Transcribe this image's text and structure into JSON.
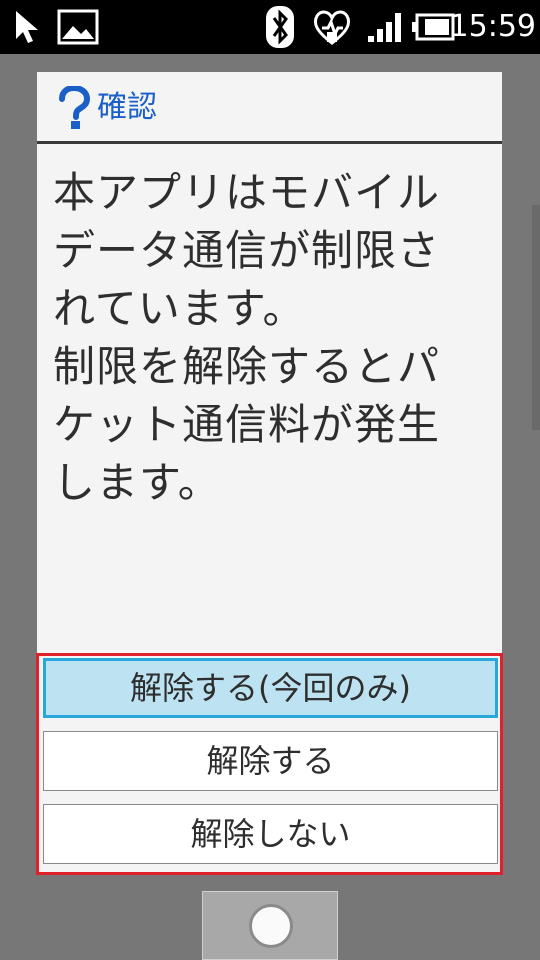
{
  "status_bar": {
    "time": "15:59",
    "icons": [
      "cursor-icon",
      "image-icon",
      "bluetooth-icon",
      "health-heart-icon",
      "signal-icon",
      "battery-icon"
    ]
  },
  "dialog": {
    "icon": "question-icon",
    "title": "確認",
    "message": "本アプリはモバイル\nデータ通信が制限さ\nれています。\n制限を解除するとパ\nケット通信料が発生\nします。",
    "buttons": [
      {
        "label": "解除する(今回のみ)",
        "focused": true
      },
      {
        "label": "解除する",
        "focused": false
      },
      {
        "label": "解除しない",
        "focused": false
      }
    ]
  },
  "colors": {
    "title_blue": "#1a5fc8",
    "focus_blue": "#2aa7d9",
    "highlight_red": "#e0202a"
  }
}
